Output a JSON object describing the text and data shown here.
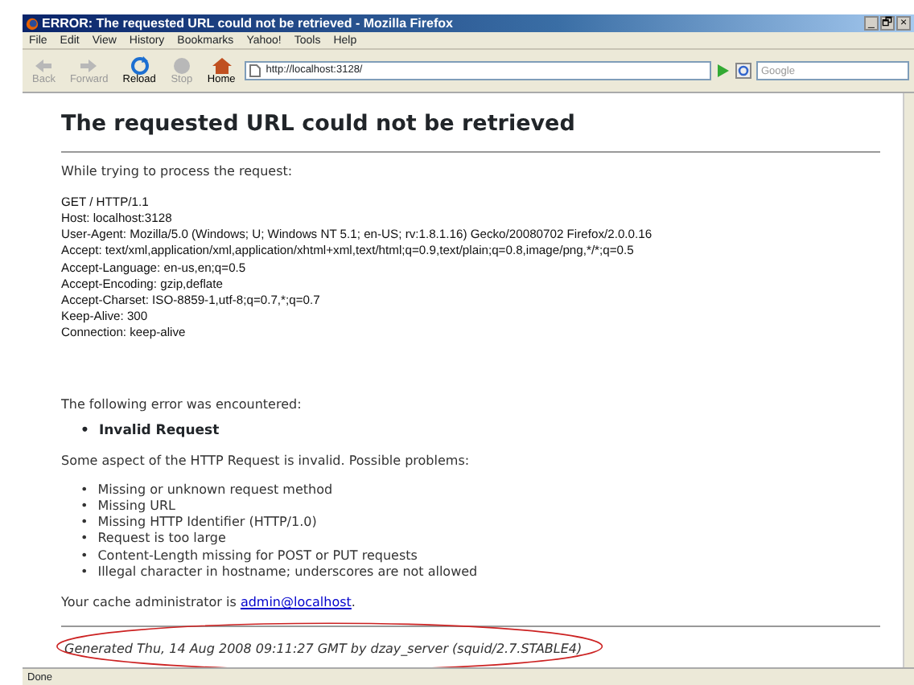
{
  "window": {
    "title": "ERROR: The requested URL could not be retrieved - Mozilla Firefox",
    "controls": [
      "_",
      "🗗",
      "×"
    ]
  },
  "menu": [
    "File",
    "Edit",
    "View",
    "History",
    "Bookmarks",
    "Yahoo!",
    "Tools",
    "Help"
  ],
  "toolbar": [
    {
      "kind": "back",
      "label": "Back",
      "disabled": true
    },
    {
      "kind": "forward",
      "label": "Forward",
      "disabled": true
    },
    {
      "kind": "reload",
      "label": "Reload",
      "disabled": false
    },
    {
      "kind": "stop",
      "label": "Stop",
      "disabled": true
    },
    {
      "kind": "home",
      "label": "Home",
      "disabled": false
    }
  ],
  "address": {
    "value": "http://localhost:3128/"
  },
  "search": {
    "placeholder": "Google"
  },
  "page": {
    "heading": "The requested URL could not be retrieved",
    "intro": "While trying to process the request:",
    "request_lines": [
      "GET / HTTP/1.1",
      "Host: localhost:3128",
      "User-Agent: Mozilla/5.0 (Windows; U; Windows NT 5.1; en-US; rv:1.8.1.16) Gecko/20080702 Firefox/2.0.0.16",
      "Accept: text/xml,application/xml,application/xhtml+xml,text/html;q=0.9,text/plain;q=0.8,image/png,*/*;q=0.5",
      "Accept-Language: en-us,en;q=0.5",
      "Accept-Encoding: gzip,deflate",
      "Accept-Charset: ISO-8859-1,utf-8;q=0.7,*;q=0.7",
      "Keep-Alive: 300",
      "Connection: keep-alive"
    ],
    "error_intro": "The following error was encountered:",
    "bullet": "•",
    "error": "Invalid Request",
    "problems_intro": "Some aspect of the HTTP Request is invalid. Possible problems:",
    "problems": [
      "Missing or unknown request method",
      "Missing URL",
      "Missing HTTP Identifier (HTTP/1.0)",
      "Request is too large",
      "Content-Length missing for POST or PUT requests",
      "Illegal character in hostname; underscores are not allowed"
    ],
    "admin_prefix": "Your cache administrator is ",
    "admin_link": "admin@localhost",
    "admin_suffix": ".",
    "footer": {
      "text": "Generated Thu, 14 Aug 2008 09:11:27 GMT by dzay_server (squid/2.7.STABLE4)",
      "circled": true
    }
  },
  "status_bar": "Done"
}
